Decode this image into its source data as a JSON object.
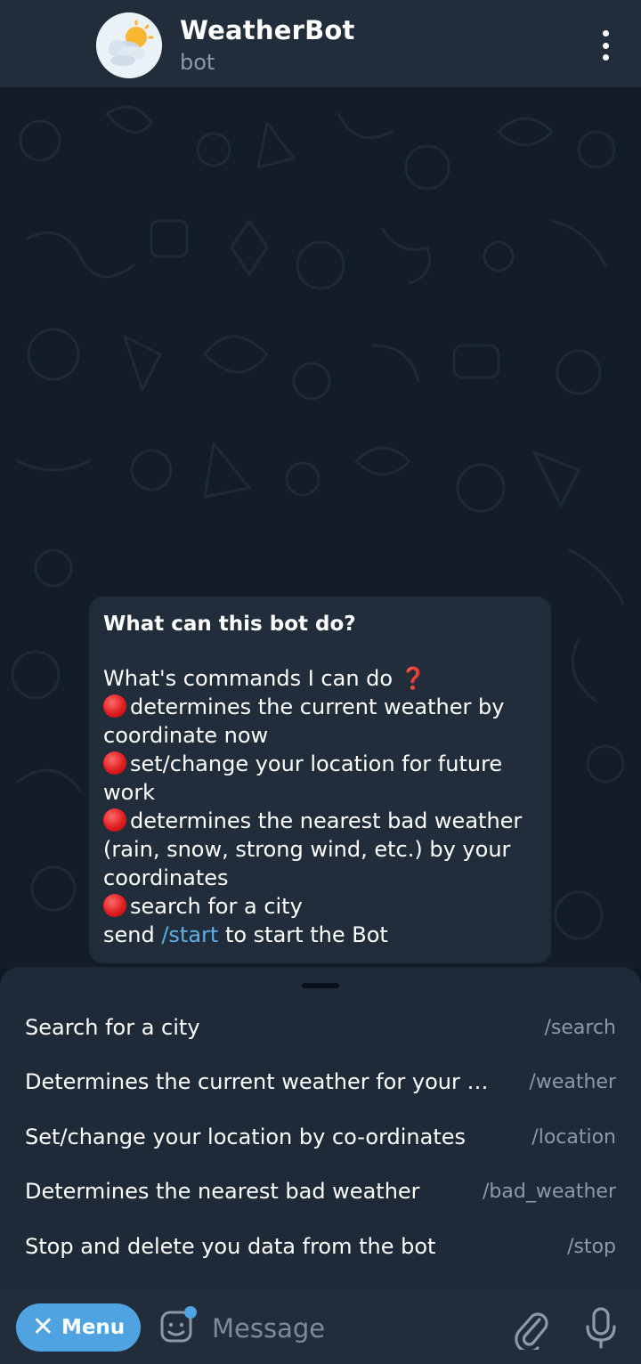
{
  "header": {
    "title": "WeatherBot",
    "subtitle": "bot",
    "avatar_icon": "weather-sun-cloud-icon",
    "more_icon": "more-vertical-icon"
  },
  "intro": {
    "heading": "What can this bot do?",
    "lines": [
      {
        "text": "What's commands I can do",
        "bullet": false,
        "suffix": "❓"
      },
      {
        "text": "determines the current weather by",
        "bullet": true
      },
      {
        "text": "coordinate now",
        "bullet": false
      },
      {
        "text": "set/change your location for future",
        "bullet": true
      },
      {
        "text": "work",
        "bullet": false
      },
      {
        "text": "determines the nearest bad weather",
        "bullet": true
      },
      {
        "text": "(rain, snow, strong wind, etc.) by your",
        "bullet": false
      },
      {
        "text": "coordinates",
        "bullet": false
      },
      {
        "text": "search for a city",
        "bullet": true
      }
    ],
    "last_line": {
      "before": "send ",
      "link": "/start",
      "after": " to start the Bot"
    }
  },
  "commands": [
    {
      "description": "Search for a city",
      "command": "/search"
    },
    {
      "description": "Determines the current weather for your s...",
      "command": "/weather"
    },
    {
      "description": "Set/change your location by co-ordinates",
      "command": "/location"
    },
    {
      "description": "Determines the nearest bad weather",
      "command": "/bad_weather"
    },
    {
      "description": "Stop and delete you data from the bot",
      "command": "/stop"
    }
  ],
  "input_bar": {
    "menu_label": "Menu",
    "placeholder": "Message"
  },
  "colors": {
    "header_bg": "#212d3b",
    "chat_bg": "#131d28",
    "accent": "#4fa3e0",
    "link": "#5eaeea",
    "muted": "#8b9aa9",
    "bullet_red": "#e01e1e"
  }
}
